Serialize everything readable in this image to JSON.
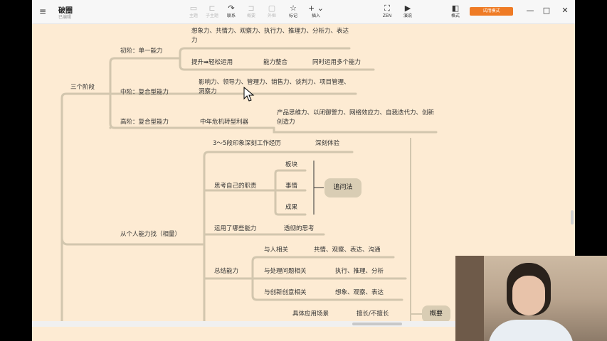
{
  "app": {
    "doc_title": "破圈",
    "doc_status": "已编辑",
    "trial_label": "试用模式"
  },
  "toolbar": {
    "items": [
      {
        "label": "主题",
        "icon": "topic-icon",
        "glyph": "▭",
        "enabled": false
      },
      {
        "label": "子主题",
        "icon": "subtopic-icon",
        "glyph": "⊏",
        "enabled": false
      },
      {
        "label": "联系",
        "icon": "relationship-icon",
        "glyph": "↷",
        "enabled": true
      },
      {
        "label": "概要",
        "icon": "summary-icon",
        "glyph": "⊐",
        "enabled": false
      },
      {
        "label": "外框",
        "icon": "boundary-icon",
        "glyph": "▢",
        "enabled": false
      },
      {
        "label": "标记",
        "icon": "marker-star-icon",
        "glyph": "☆",
        "enabled": true
      },
      {
        "label": "插入",
        "icon": "insert-plus-icon",
        "glyph": "+ ⌄",
        "enabled": true
      },
      {
        "label": "ZEN",
        "icon": "zen-mode-icon",
        "glyph": "⛶",
        "enabled": true
      },
      {
        "label": "演说",
        "icon": "pitch-play-icon",
        "glyph": "▶",
        "enabled": true
      },
      {
        "label": "格式",
        "icon": "format-panel-icon",
        "glyph": "◧",
        "enabled": true
      }
    ]
  },
  "window": {
    "minimize": "—",
    "maximize": "□",
    "close": "✕",
    "menu": "≡"
  },
  "mindmap": {
    "stages": {
      "label": "三个阶段",
      "stage1": {
        "label": "初阶：单一能力",
        "abilities": "想象力、共情力、观察力、执行力、推理力、分析力、表达力",
        "step1": "提升➡轻松运用",
        "step2": "能力整合",
        "step3": "同时运用多个能力"
      },
      "stage2": {
        "label": "中阶：复合型能力",
        "abilities": "影响力、领导力、管理力、销售力、谈判力、项目管理、洞察力"
      },
      "stage3": {
        "label": "高阶：复合型能力",
        "weapon": "中年危机转型利器",
        "abilities": "产品思维力、以闭御警力、网络效应力、自我迭代力、创新创造力"
      }
    },
    "find": {
      "label": "从个人能力找（相量）",
      "exp": "3～5段印象深刻工作经历",
      "exp_note": "深刻体验",
      "duty": "思考自己的职责",
      "duty_items": [
        "板块",
        "事情",
        "成果"
      ],
      "method": "追问法",
      "used": "运用了哪些能力",
      "used_note": "透彻的思考",
      "summary": "总结能力",
      "groups": [
        {
          "label": "与人相关",
          "items": "共情、观察、表达、沟通"
        },
        {
          "label": "与处理问题相关",
          "items": "执行、推理、分析"
        },
        {
          "label": "与创新创意相关",
          "items": "想象、观察、表达"
        }
      ],
      "scenario": "具体应用场景",
      "scenario_note": "擅长/不擅长",
      "overview": "概要"
    }
  }
}
